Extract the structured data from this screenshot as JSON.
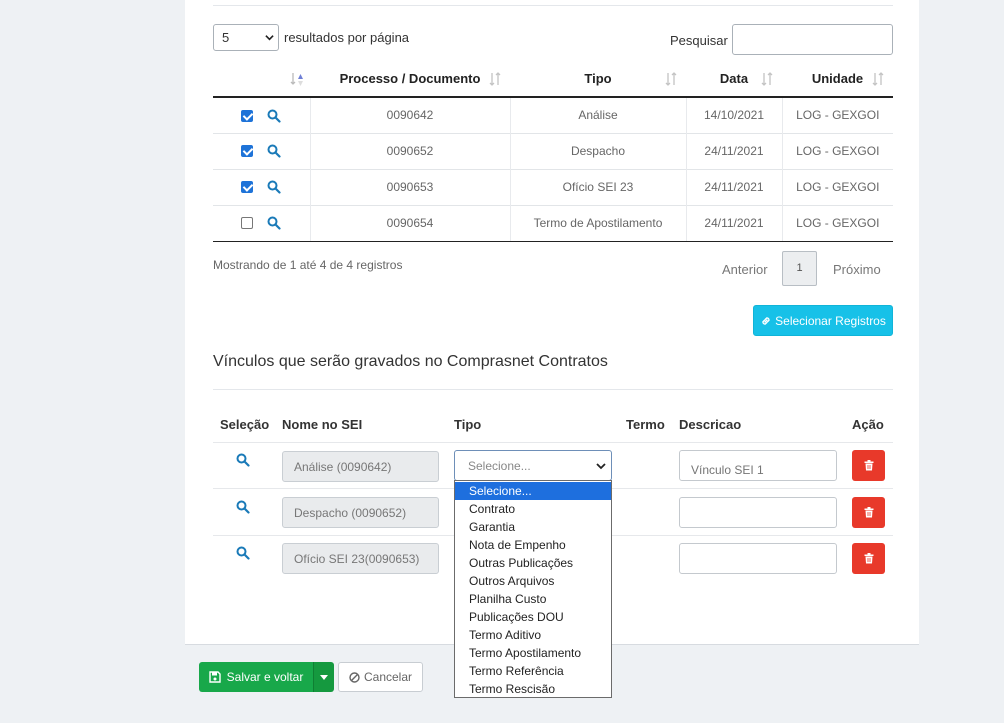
{
  "colors": {
    "accent": "#17c1e8",
    "primary": "#1e73d8",
    "danger": "#e8392a",
    "success": "#18a84a"
  },
  "table_controls": {
    "length_value": "5",
    "length_label": "resultados por página",
    "search_label": "Pesquisar",
    "search_value": ""
  },
  "records_table": {
    "headers": [
      "Processo / Documento",
      "Tipo",
      "Data",
      "Unidade"
    ],
    "rows": [
      {
        "checked": true,
        "processo": "0090642",
        "tipo": "Análise",
        "data": "14/10/2021",
        "unidade": "LOG - GEXGOI"
      },
      {
        "checked": true,
        "processo": "0090652",
        "tipo": "Despacho",
        "data": "24/11/2021",
        "unidade": "LOG - GEXGOI"
      },
      {
        "checked": true,
        "processo": "0090653",
        "tipo": "Ofício SEI 23",
        "data": "24/11/2021",
        "unidade": "LOG - GEXGOI"
      },
      {
        "checked": false,
        "processo": "0090654",
        "tipo": "Termo de Apostilamento",
        "data": "24/11/2021",
        "unidade": "LOG - GEXGOI"
      }
    ]
  },
  "pagination": {
    "info": "Mostrando de 1 até 4 de 4 registros",
    "prev": "Anterior",
    "page": "1",
    "next": "Próximo"
  },
  "select_button": {
    "label": "Selecionar Registros",
    "icon": "link-icon"
  },
  "vinculos": {
    "title": "Vínculos que serão gravados no Comprasnet Contratos",
    "headers": {
      "selecao": "Seleção",
      "nome": "Nome no SEI",
      "tipo": "Tipo",
      "termo": "Termo",
      "descricao": "Descricao",
      "acao": "Ação"
    },
    "rows": [
      {
        "nome": "Análise (0090642)",
        "descricao": "",
        "descricao_placeholder": "Vínculo SEI 1"
      },
      {
        "nome": "Despacho (0090652)",
        "descricao": "",
        "descricao_placeholder": ""
      },
      {
        "nome": "Ofício SEI 23(0090653)",
        "descricao": "",
        "descricao_placeholder": ""
      }
    ],
    "tipo_selected": "Selecione...",
    "tipo_options": [
      "Selecione...",
      "Contrato",
      "Garantia",
      "Nota de Empenho",
      "Outras Publicações",
      "Outros Arquivos",
      "Planilha Custo",
      "Publicações DOU",
      "Termo Aditivo",
      "Termo Apostilamento",
      "Termo Referência",
      "Termo Rescisão"
    ]
  },
  "footer": {
    "save_label": "Salvar e voltar",
    "cancel_label": "Cancelar"
  }
}
